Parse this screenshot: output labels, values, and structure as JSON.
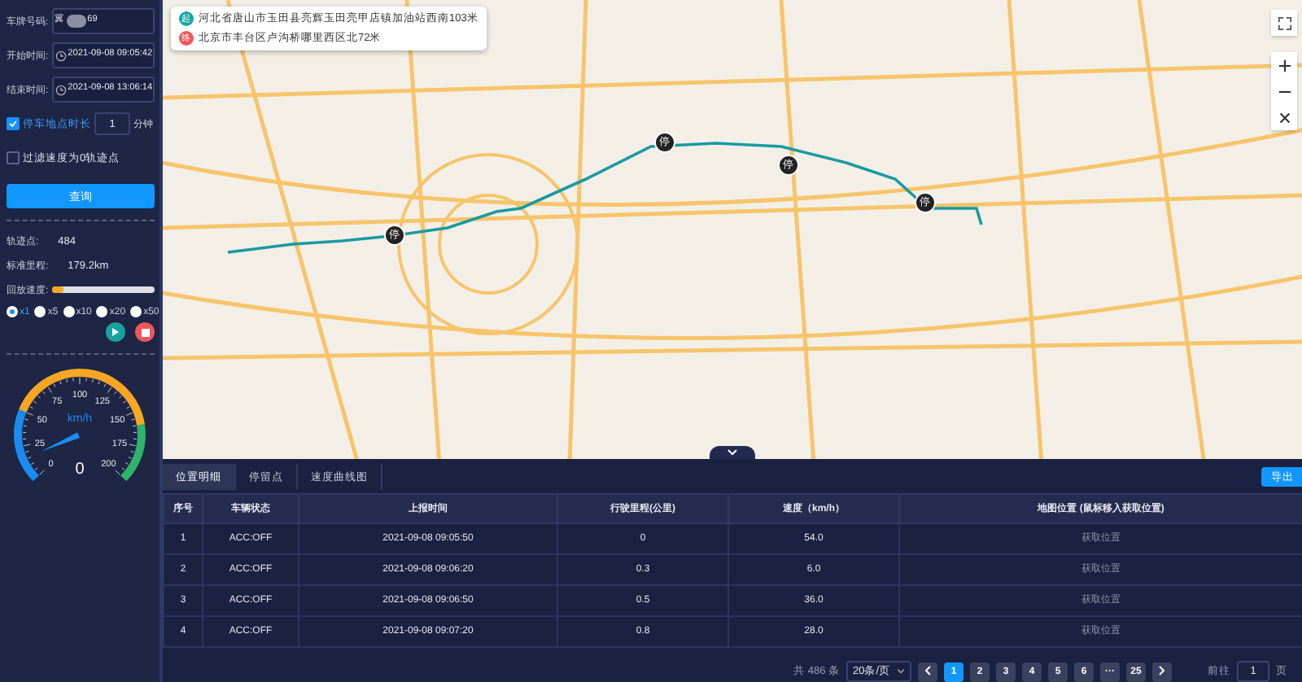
{
  "sidebar": {
    "plate": {
      "label": "车牌号码:",
      "prefix": "冀",
      "suffix": "69"
    },
    "start": {
      "label": "开始时间:",
      "value": "2021-09-08 09:05:42"
    },
    "end": {
      "label": "结束时间:",
      "value": "2021-09-08 13:06:14"
    },
    "options": [
      {
        "kind": "duration",
        "label": "停车地点时长",
        "checked": true,
        "value": "1",
        "unit": "分钟"
      },
      {
        "kind": "plain",
        "label": "过滤速度为0轨迹点",
        "checked": false
      }
    ],
    "query_button": "查询",
    "stats": [
      {
        "label": "轨迹点:",
        "value": "484"
      },
      {
        "label": "标准里程:",
        "value": "179.2km"
      }
    ],
    "playback": {
      "label": "回放速度:",
      "level": 0.12
    },
    "rates": [
      {
        "label": "x1",
        "selected": true
      },
      {
        "label": "x5",
        "selected": false
      },
      {
        "label": "x10",
        "selected": false
      },
      {
        "label": "x20",
        "selected": false
      },
      {
        "label": "x50",
        "selected": false
      }
    ],
    "gauge": {
      "unit": "km/h",
      "reading": "0",
      "ticks": [
        "0",
        "25",
        "50",
        "75",
        "100",
        "125",
        "150",
        "175",
        "200"
      ]
    }
  },
  "map": {
    "addresses": [
      {
        "kind": "start",
        "icon": "起",
        "text": "河北省唐山市玉田县亮辉玉田亮甲店镇加油站西南103米"
      },
      {
        "kind": "end",
        "icon": "终",
        "text": "北京市丰台区卢沟桥哪里西区北72米"
      }
    ],
    "stops": [
      {
        "label": "停"
      },
      {
        "label": "停"
      },
      {
        "label": "停"
      },
      {
        "label": "停"
      }
    ]
  },
  "panel": {
    "tabs": [
      {
        "label": "位置明细",
        "selected": true
      },
      {
        "label": "停留点",
        "selected": false
      },
      {
        "label": "速度曲线图",
        "selected": false
      }
    ],
    "export_button": "导出",
    "table": {
      "columns": [
        "序号",
        "车辆状态",
        "上报时间",
        "行驶里程(公里)",
        "速度（km/h）",
        "地图位置 (鼠标移入获取位置)"
      ],
      "rows": [
        [
          "1",
          "ACC:OFF",
          "2021-09-08 09:05:50",
          "0",
          "54.0",
          "获取位置"
        ],
        [
          "2",
          "ACC:OFF",
          "2021-09-08 09:06:20",
          "0.3",
          "6.0",
          "获取位置"
        ],
        [
          "3",
          "ACC:OFF",
          "2021-09-08 09:06:50",
          "0.5",
          "36.0",
          "获取位置"
        ],
        [
          "4",
          "ACC:OFF",
          "2021-09-08 09:07:20",
          "0.8",
          "28.0",
          "获取位置"
        ]
      ]
    },
    "pagination": {
      "total": "共 486 条",
      "page_size": "20条/页",
      "pages": [
        {
          "label": "1",
          "selected": true
        },
        {
          "label": "2",
          "selected": false
        },
        {
          "label": "3",
          "selected": false
        },
        {
          "label": "4",
          "selected": false
        },
        {
          "label": "5",
          "selected": false
        },
        {
          "label": "6",
          "selected": false
        },
        {
          "label": "···",
          "selected": false
        },
        {
          "label": "25",
          "selected": false
        }
      ],
      "goto_label": "前往",
      "goto_value": "1",
      "goto_unit": "页"
    }
  }
}
